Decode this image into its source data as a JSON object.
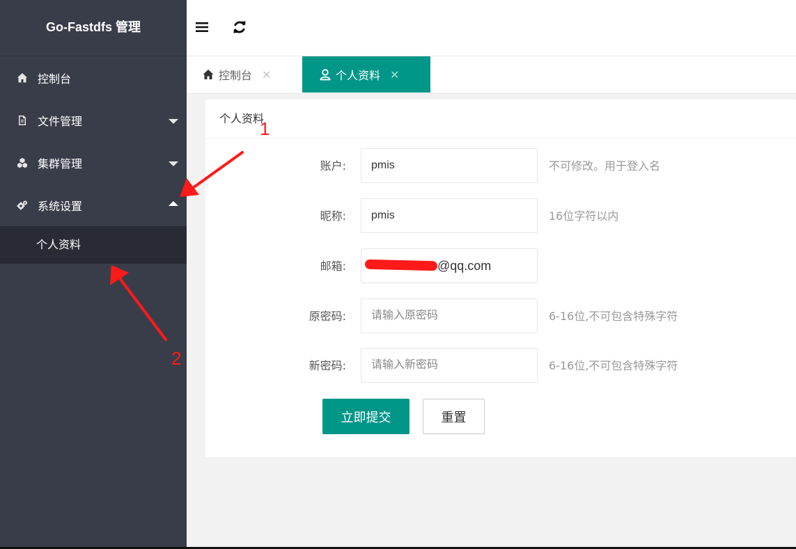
{
  "app": {
    "title": "Go-Fastdfs 管理"
  },
  "sidebar": {
    "items": [
      {
        "label": "控制台",
        "icon": "home-icon"
      },
      {
        "label": "文件管理",
        "icon": "file-icon",
        "expanded": false
      },
      {
        "label": "集群管理",
        "icon": "cubes-icon",
        "expanded": false
      },
      {
        "label": "系统设置",
        "icon": "cogs-icon",
        "expanded": true
      }
    ],
    "subitems": [
      {
        "label": "个人资料"
      }
    ]
  },
  "header": {
    "menu_icon": "hamburger-icon",
    "refresh_icon": "refresh-icon"
  },
  "tabs": [
    {
      "label": "控制台",
      "icon": "home-icon",
      "close": "✕",
      "active": false
    },
    {
      "label": "个人资料",
      "icon": "user-icon",
      "close": "✕",
      "active": true
    }
  ],
  "card": {
    "title": "个人资料",
    "fields": {
      "account": {
        "label": "账户:",
        "value": "pmis",
        "hint": "不可修改。用于登入名"
      },
      "nickname": {
        "label": "昵称:",
        "value": "pmis",
        "hint": "16位字符以内"
      },
      "email": {
        "label": "邮箱:",
        "value_visible": "@qq.com",
        "hint": ""
      },
      "old_password": {
        "label": "原密码:",
        "placeholder": "请输入原密码",
        "hint": "6-16位,不可包含特殊字符"
      },
      "new_password": {
        "label": "新密码:",
        "placeholder": "请输入新密码",
        "hint": "6-16位,不可包含特殊字符"
      }
    },
    "buttons": {
      "submit": "立即提交",
      "reset": "重置"
    }
  },
  "annotations": {
    "label_1": "1",
    "label_2": "2",
    "color": "#ff1a1a"
  },
  "colors": {
    "sidebar_bg": "#393d49",
    "sidebar_sub_bg": "#282b33",
    "accent": "#009688"
  }
}
